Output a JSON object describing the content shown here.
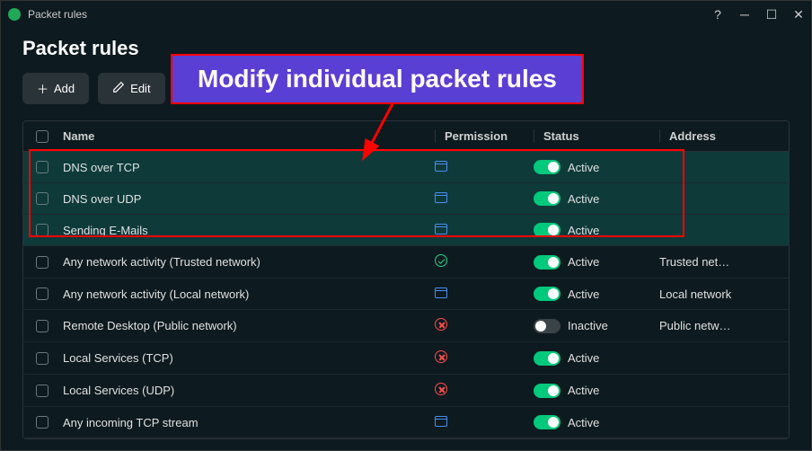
{
  "window": {
    "title": "Packet rules"
  },
  "page": {
    "heading": "Packet rules"
  },
  "actions": {
    "add": "Add",
    "edit": "Edit"
  },
  "callout": {
    "text": "Modify individual packet rules"
  },
  "columns": {
    "name": "Name",
    "permission": "Permission",
    "status": "Status",
    "address": "Address"
  },
  "status_labels": {
    "active": "Active",
    "inactive": "Inactive"
  },
  "rules": [
    {
      "name": "DNS over TCP",
      "permission": "window",
      "active": true,
      "address": "",
      "highlight": true
    },
    {
      "name": "DNS over UDP",
      "permission": "window",
      "active": true,
      "address": "",
      "highlight": true
    },
    {
      "name": "Sending E-Mails",
      "permission": "window",
      "active": true,
      "address": "",
      "highlight": true
    },
    {
      "name": "Any network activity (Trusted network)",
      "permission": "check",
      "active": true,
      "address": "Trusted net…",
      "highlight": false
    },
    {
      "name": "Any network activity (Local network)",
      "permission": "window",
      "active": true,
      "address": "Local network",
      "highlight": false
    },
    {
      "name": "Remote Desktop (Public network)",
      "permission": "deny",
      "active": false,
      "address": "Public netw…",
      "highlight": false
    },
    {
      "name": "Local Services (TCP)",
      "permission": "deny",
      "active": true,
      "address": "",
      "highlight": false
    },
    {
      "name": "Local Services (UDP)",
      "permission": "deny",
      "active": true,
      "address": "",
      "highlight": false
    },
    {
      "name": "Any incoming TCP stream",
      "permission": "window",
      "active": true,
      "address": "",
      "highlight": false
    }
  ]
}
